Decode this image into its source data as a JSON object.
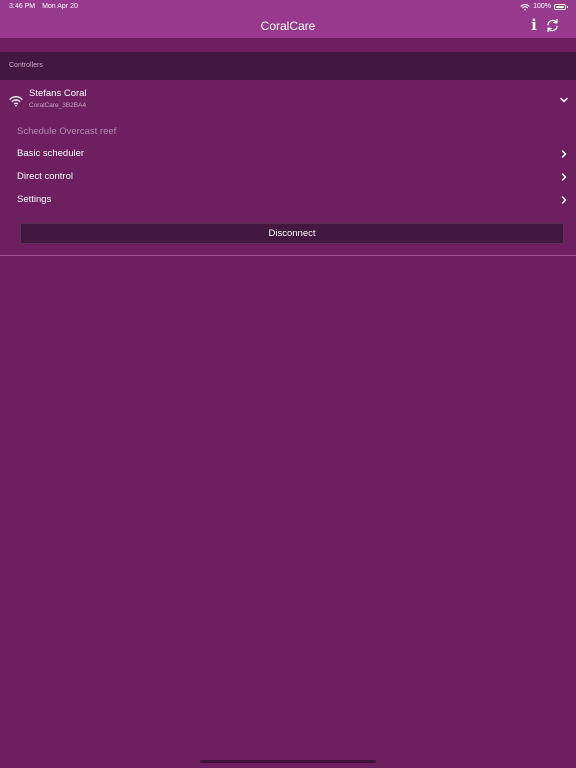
{
  "status_bar": {
    "time": "3:46 PM",
    "date": "Mon Apr 20",
    "battery": "100%",
    "battery_level": 1.0,
    "wifi_icon": "wifi-icon",
    "battery_icon": "battery-icon"
  },
  "nav": {
    "title": "CoralCare",
    "info_icon": "info-icon",
    "info_glyph": "i",
    "refresh_icon": "refresh-icon"
  },
  "section": {
    "header": "Controllers"
  },
  "controller": {
    "name": "Stefans Coral",
    "id": "CoralCare_3B2BA4",
    "icon": "wifi-icon",
    "expand_icon": "chevron-down-icon"
  },
  "menu": {
    "schedule_label": "Schedule Overcast reef",
    "items": [
      {
        "label": "Basic scheduler",
        "icon": "chevron-right-icon"
      },
      {
        "label": "Direct control",
        "icon": "chevron-right-icon"
      },
      {
        "label": "Settings",
        "icon": "chevron-right-icon"
      }
    ]
  },
  "disconnect_label": "Disconnect",
  "colors": {
    "nav_background": "#97398c",
    "page_background": "#6e1f60",
    "section_background": "#421840",
    "text": "#ffffff",
    "muted_text": "#b48aaf"
  }
}
